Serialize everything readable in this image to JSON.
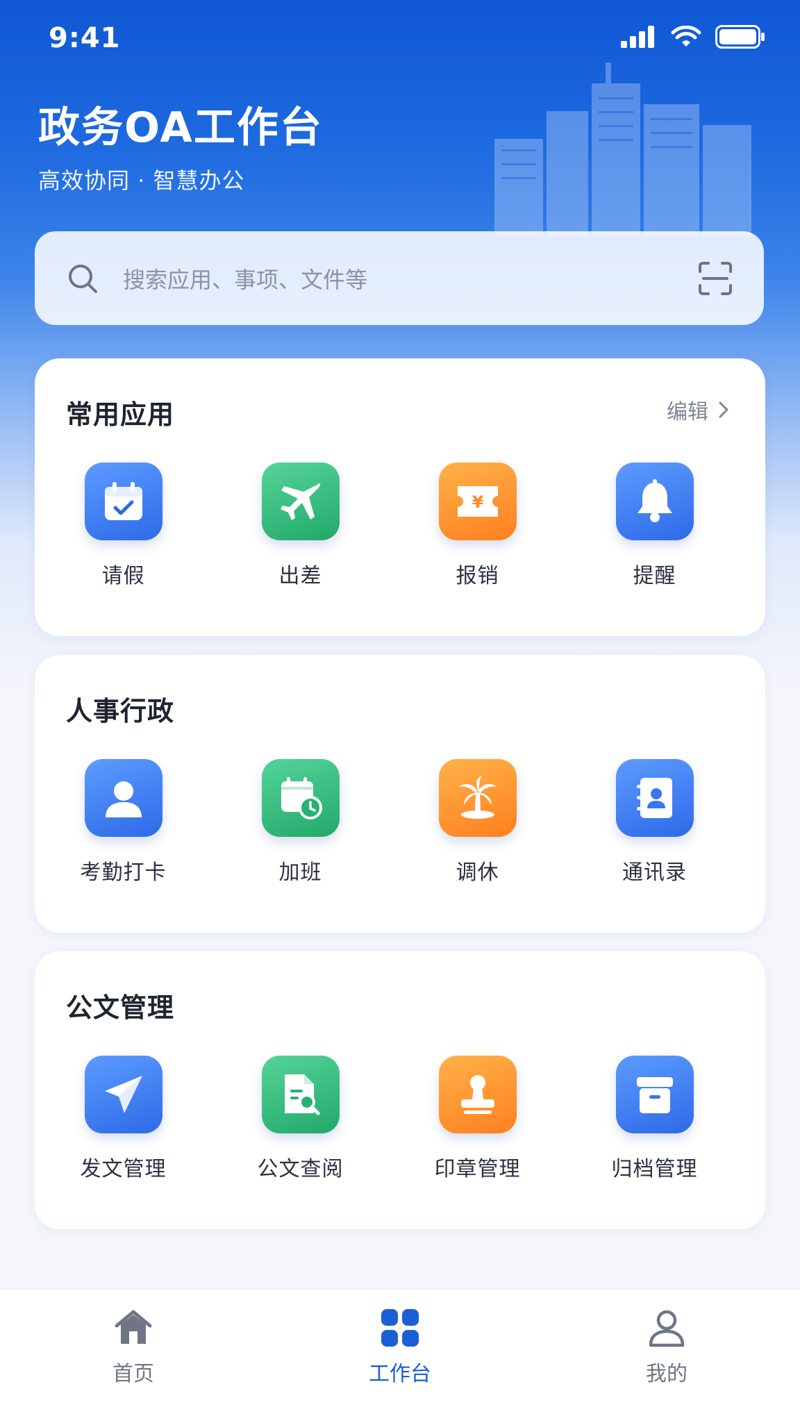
{
  "status_bar": {
    "time": "9:41"
  },
  "header": {
    "title": "政务OA工作台",
    "subtitle": "高效协同 · 智慧办公"
  },
  "search": {
    "placeholder": "搜索应用、事项、文件等",
    "search_icon": "search-icon",
    "scan_icon": "scan-icon"
  },
  "sections": [
    {
      "title": "常用应用",
      "action": "编辑",
      "apps": [
        {
          "label": "请假",
          "icon": "calendar-check-icon",
          "color": "blue"
        },
        {
          "label": "出差",
          "icon": "airplane-icon",
          "color": "green"
        },
        {
          "label": "报销",
          "icon": "yen-ticket-icon",
          "color": "orange"
        },
        {
          "label": "提醒",
          "icon": "bell-icon",
          "color": "blue"
        }
      ]
    },
    {
      "title": "人事行政",
      "apps": [
        {
          "label": "考勤打卡",
          "icon": "user-icon",
          "color": "blue"
        },
        {
          "label": "加班",
          "icon": "calendar-clock-icon",
          "color": "green"
        },
        {
          "label": "调休",
          "icon": "palm-tree-icon",
          "color": "orange"
        },
        {
          "label": "通讯录",
          "icon": "contact-book-icon",
          "color": "blue"
        }
      ]
    },
    {
      "title": "公文管理",
      "apps": [
        {
          "label": "发文管理",
          "icon": "paper-plane-icon",
          "color": "blue"
        },
        {
          "label": "公文查阅",
          "icon": "document-search-icon",
          "color": "green"
        },
        {
          "label": "印章管理",
          "icon": "stamp-icon",
          "color": "orange"
        },
        {
          "label": "归档管理",
          "icon": "archive-box-icon",
          "color": "blue"
        }
      ]
    }
  ],
  "tabbar": [
    {
      "label": "首页",
      "icon": "home-icon",
      "active": false
    },
    {
      "label": "工作台",
      "icon": "grid-icon",
      "active": true
    },
    {
      "label": "我的",
      "icon": "profile-icon",
      "active": false
    }
  ],
  "colors": {
    "primary": "#1a5fd8",
    "blue_tile": "#3b7bf0",
    "green_tile": "#2fb877",
    "orange_tile": "#ff8c2a"
  }
}
